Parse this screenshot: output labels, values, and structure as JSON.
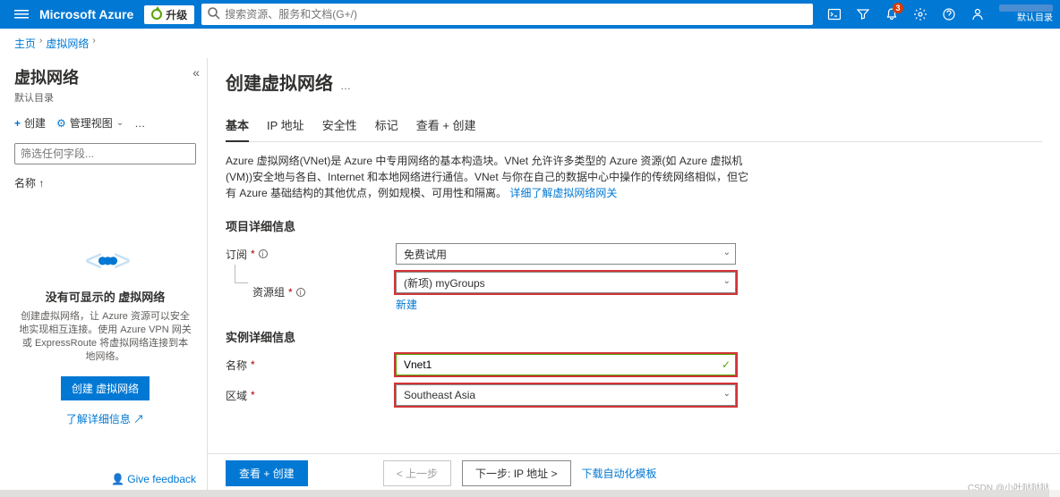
{
  "topbar": {
    "brand": "Microsoft Azure",
    "upgrade": "升级",
    "search_placeholder": "搜索资源、服务和文档(G+/)",
    "notification_count": "3",
    "directory": "默认目录"
  },
  "breadcrumb": {
    "home": "主页",
    "vnet": "虚拟网络"
  },
  "sidebar": {
    "title": "虚拟网络",
    "subtitle": "默认目录",
    "create": "创建",
    "manage_view": "管理视图",
    "more": "…",
    "filter_placeholder": "筛选任何字段...",
    "sort_label": "名称 ↑",
    "empty_title": "没有可显示的 虚拟网络",
    "empty_desc": "创建虚拟网络，让 Azure 资源可以安全地实现相互连接。使用 Azure VPN 网关或 ExpressRoute 将虚拟网络连接到本地网络。",
    "empty_btn": "创建 虚拟网络",
    "learn_more": "了解详细信息",
    "feedback": "Give feedback"
  },
  "main": {
    "title": "创建虚拟网络",
    "tabs": {
      "basic": "基本",
      "ip": "IP 地址",
      "security": "安全性",
      "tags": "标记",
      "review": "查看 + 创建"
    },
    "description": "Azure 虚拟网络(VNet)是 Azure 中专用网络的基本构造块。VNet 允许许多类型的 Azure 资源(如 Azure 虚拟机(VM))安全地与各自、Internet 和本地网络进行通信。VNet 与你在自己的数据中心中操作的传统网络相似，但它有 Azure 基础结构的其他优点，例如规模、可用性和隔离。",
    "desc_link": "详细了解虚拟网络网关",
    "section_project": "项目详细信息",
    "subscription_label": "订阅",
    "subscription_value": "免费试用",
    "rg_label": "资源组",
    "rg_value": "(新项) myGroups",
    "rg_new": "新建",
    "section_instance": "实例详细信息",
    "name_label": "名称",
    "name_value": "Vnet1",
    "region_label": "区域",
    "region_value": "Southeast Asia"
  },
  "footer": {
    "review": "查看 + 创建",
    "prev": "< 上一步",
    "next": "下一步: IP 地址 >",
    "download": "下载自动化模板"
  },
  "watermark": "CSDN @小叶哒哒哒"
}
